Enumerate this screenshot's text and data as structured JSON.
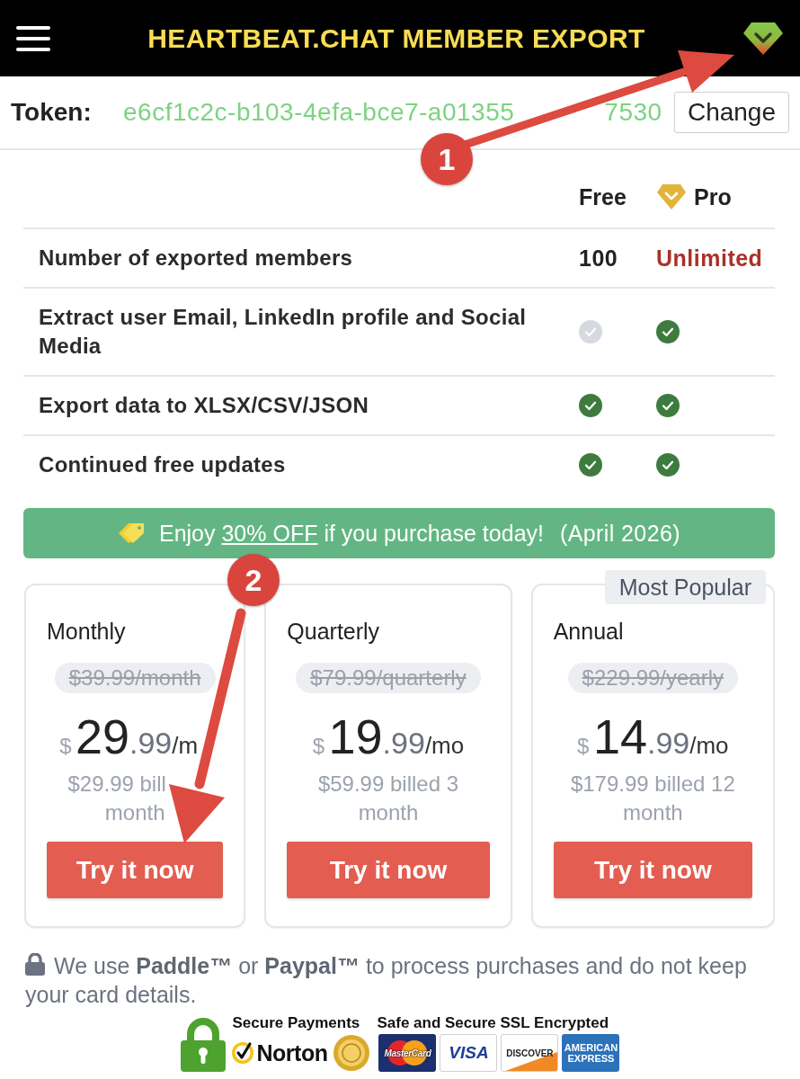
{
  "header": {
    "title": "HEARTBEAT.CHAT MEMBER EXPORT"
  },
  "token": {
    "label": "Token:",
    "value_parts": [
      "e6cf1c2c-b103-4efa-bce7-a01355",
      "7530"
    ],
    "button": "Change"
  },
  "comparison": {
    "columns": [
      {
        "label": "Free",
        "kind": "plain"
      },
      {
        "label": "Pro",
        "kind": "premium"
      }
    ],
    "rows": [
      {
        "feature": "Number of exported members",
        "cells": [
          {
            "kind": "text",
            "text": "100"
          },
          {
            "kind": "highlight",
            "text": "Unlimited"
          }
        ]
      },
      {
        "feature": "Extract user Email, LinkedIn profile and Social Media",
        "cells": [
          {
            "kind": "check",
            "checked": false
          },
          {
            "kind": "check",
            "checked": true
          }
        ]
      },
      {
        "feature": "Export data to XLSX/CSV/JSON",
        "cells": [
          {
            "kind": "check",
            "checked": true
          },
          {
            "kind": "check",
            "checked": true
          }
        ]
      },
      {
        "feature": "Continued free updates",
        "cells": [
          {
            "kind": "check",
            "checked": true
          },
          {
            "kind": "check",
            "checked": true
          }
        ]
      }
    ]
  },
  "promo": {
    "lead": "Enjoy",
    "offer": "30% OFF",
    "rest": "if you purchase today!",
    "date": "(April 2026)"
  },
  "plans": [
    {
      "name": "Monthly",
      "old_price": "$39.99/month",
      "currency": "$",
      "amount": "29",
      "cents": ".99",
      "unit": "/m",
      "billed": [
        "$29.99 bill",
        "month"
      ],
      "button": "Try it now"
    },
    {
      "name": "Quarterly",
      "old_price": "$79.99/quarterly",
      "currency": "$",
      "amount": "19",
      "cents": ".99",
      "unit": "/mo",
      "billed": [
        "$59.99 billed 3 month"
      ],
      "button": "Try it now"
    },
    {
      "name": "Annual",
      "badge": "Most Popular",
      "old_price": "$229.99/yearly",
      "currency": "$",
      "amount": "14",
      "cents": ".99",
      "unit": "/mo",
      "billed": [
        "$179.99 billed 12 month"
      ],
      "button": "Try it now"
    }
  ],
  "security": {
    "note": "We use **Paddle™** or **Paypal™** to process purchases and do not keep your card details.",
    "secure_payments": "Secure Payments",
    "ssl": "Safe and Secure SSL Encrypted",
    "norton": "Norton",
    "cards": [
      {
        "kind": "mastercard",
        "text": "MasterCard"
      },
      {
        "kind": "visa",
        "text": "VISA"
      },
      {
        "kind": "discover",
        "text": "DISCOVER"
      },
      {
        "kind": "amex",
        "text": "AMERICAN EXPRESS"
      }
    ]
  },
  "annotations": [
    {
      "number": "1"
    },
    {
      "number": "2"
    }
  ]
}
